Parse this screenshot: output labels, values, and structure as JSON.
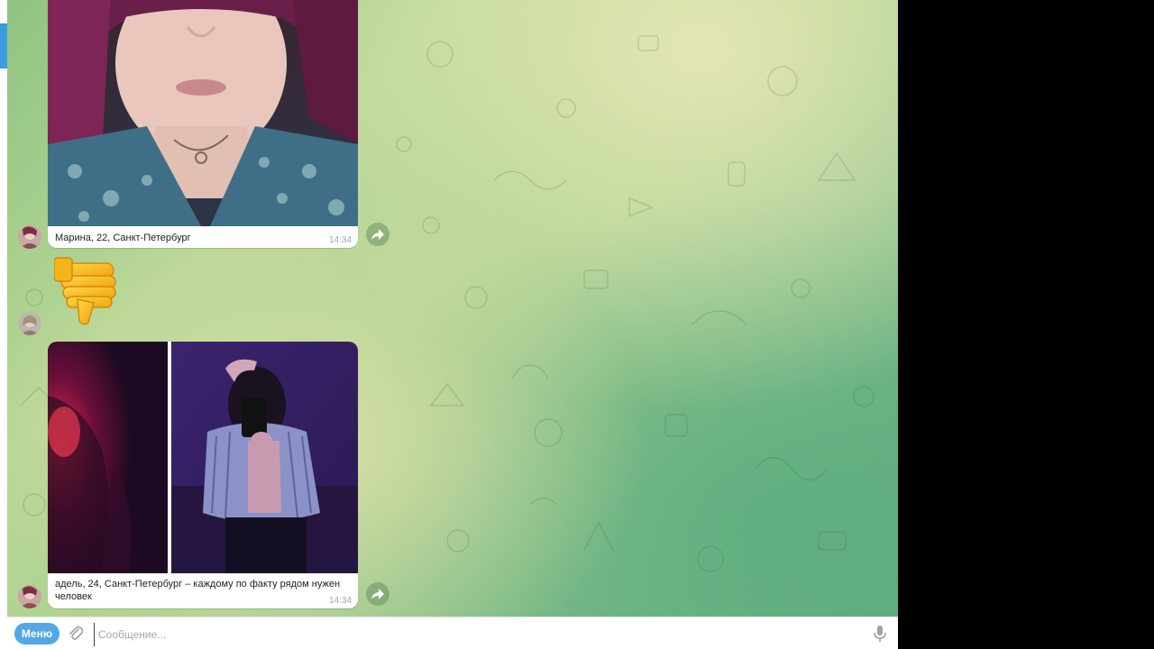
{
  "messages": [
    {
      "type": "photo",
      "caption": "Марина, 22, Санкт-Петербург",
      "time": "14:34"
    },
    {
      "type": "emoji",
      "emoji": "👎"
    },
    {
      "type": "album",
      "caption": "адель, 24, Санкт-Петербург – каждому по факту рядом нужен человек",
      "time": "14:34"
    }
  ],
  "composer": {
    "menu_label": "Меню",
    "placeholder": "Сообщение..."
  },
  "icons": {
    "forward": "forward-arrow-icon",
    "attach": "paperclip-icon",
    "mic": "microphone-icon"
  },
  "colors": {
    "accent": "#54a7e6",
    "bubble": "#ffffff"
  }
}
